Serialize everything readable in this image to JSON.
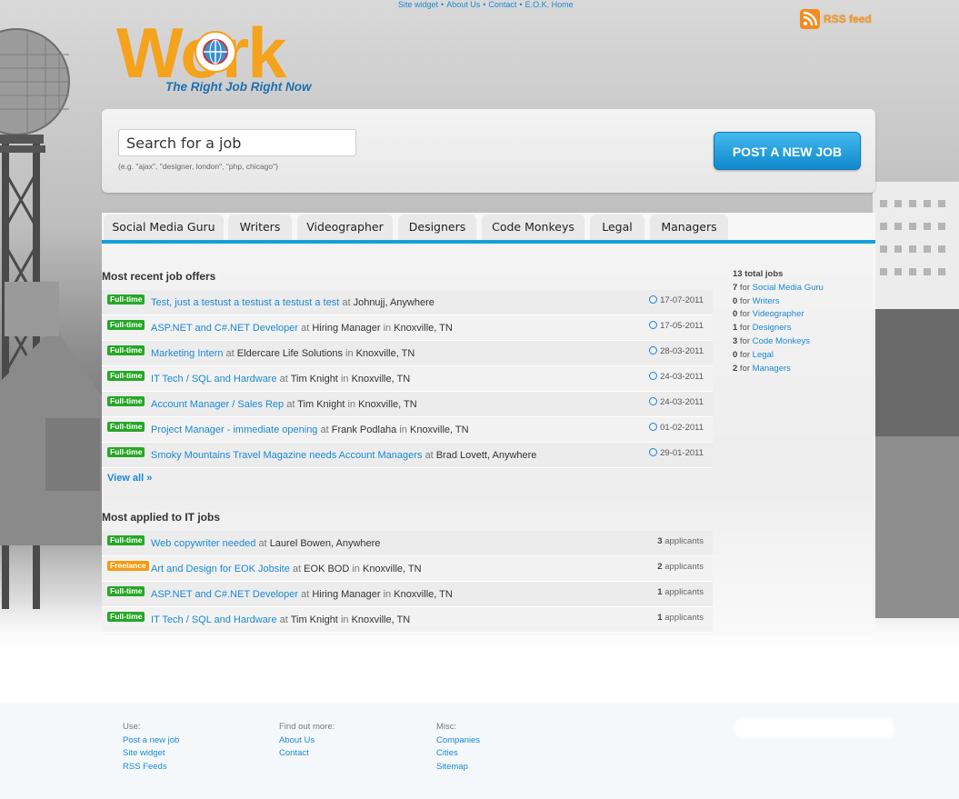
{
  "top_links": [
    "Site widget",
    "About Us",
    "Contact",
    "E.O.K. Home"
  ],
  "logo": {
    "word": "Work",
    "tagline": "The Right Job Right Now"
  },
  "rss": {
    "label": "RSS feed",
    "icon": "rss-icon"
  },
  "search": {
    "placeholder": "Search for a job",
    "hint": "(e.g. \"ajax\", \"designer, london\", \"php, chicago\")"
  },
  "post_button": "POST A NEW JOB",
  "tabs": [
    "Social Media Guru",
    "Writers",
    "Videographer",
    "Designers",
    "Code Monkeys",
    "Legal",
    "Managers"
  ],
  "recent": {
    "title": "Most recent job offers",
    "rows": [
      {
        "type": "Full-time",
        "title": "Test, just a testust a testust a testust a test",
        "company": "Johnujj",
        "location": "Anywhere",
        "date": "17-07-2011"
      },
      {
        "type": "Full-time",
        "title": "ASP.NET and C#.NET Developer",
        "company": "Hiring Manager",
        "location": "Knoxville, TN",
        "date": "17-05-2011"
      },
      {
        "type": "Full-time",
        "title": "Marketing Intern",
        "company": "Eldercare Life Solutions",
        "location": "Knoxville, TN",
        "date": "28-03-2011"
      },
      {
        "type": "Full-time",
        "title": "IT Tech / SQL and Hardware",
        "company": "Tim Knight",
        "location": "Knoxville, TN",
        "date": "24-03-2011"
      },
      {
        "type": "Full-time",
        "title": "Account Manager / Sales Rep",
        "company": "Tim Knight",
        "location": "Knoxville, TN",
        "date": "24-03-2011"
      },
      {
        "type": "Full-time",
        "title": "Project Manager - immediate opening",
        "company": "Frank Podlaha",
        "location": "Knoxville, TN",
        "date": "01-02-2011"
      },
      {
        "type": "Full-time",
        "title": "Smoky Mountains Travel Magazine needs Account Managers",
        "company": "Brad Lovett",
        "location": "Anywhere",
        "date": "29-01-2011"
      }
    ],
    "view_all": "View all »"
  },
  "applied": {
    "title": "Most applied to IT jobs",
    "rows": [
      {
        "type": "Full-time",
        "title": "Web copywriter needed",
        "company": "Laurel Bowen",
        "location": "Anywhere",
        "count": "3",
        "suffix": "applicants"
      },
      {
        "type": "Freelance",
        "title": "Art and Design for EOK Jobsite",
        "company": "EOK BOD",
        "location": "Knoxville, TN",
        "count": "2",
        "suffix": "applicants"
      },
      {
        "type": "Full-time",
        "title": "ASP.NET and C#.NET Developer",
        "company": "Hiring Manager",
        "location": "Knoxville, TN",
        "count": "1",
        "suffix": "applicants"
      },
      {
        "type": "Full-time",
        "title": "IT Tech / SQL and Hardware",
        "company": "Tim Knight",
        "location": "Knoxville, TN",
        "count": "1",
        "suffix": "applicants"
      }
    ]
  },
  "stats": {
    "total": "13 total jobs",
    "rows": [
      {
        "count": "7",
        "label": "Social Media Guru"
      },
      {
        "count": "0",
        "label": "Writers"
      },
      {
        "count": "0",
        "label": "Videographer"
      },
      {
        "count": "1",
        "label": "Designers"
      },
      {
        "count": "3",
        "label": "Code Monkeys"
      },
      {
        "count": "0",
        "label": "Legal"
      },
      {
        "count": "2",
        "label": "Managers"
      }
    ]
  },
  "footer": {
    "use": {
      "heading": "Use:",
      "links": [
        "Post a new job",
        "Site widget",
        "RSS Feeds"
      ]
    },
    "find": {
      "heading": "Find out more:",
      "links": [
        "About Us",
        "Contact"
      ]
    },
    "misc": {
      "heading": "Misc:",
      "links": [
        "Companies",
        "Cities",
        "Sitemap"
      ]
    }
  },
  "colors": {
    "accent": "#15a0d8",
    "brand_orange": "#f5a21d",
    "fulltime": "#27a727",
    "freelance": "#f39c12",
    "link": "#1b8ad0"
  }
}
